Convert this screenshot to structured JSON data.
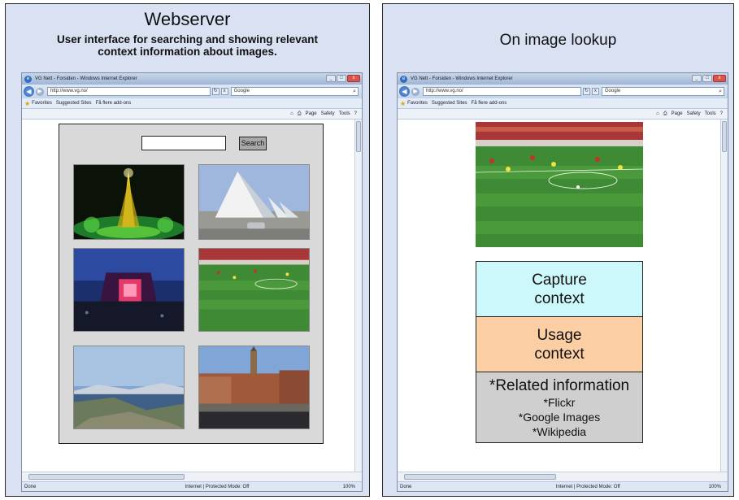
{
  "left_panel": {
    "title": "Webserver",
    "subtitle": "User interface for searching and showing relevant context information about images."
  },
  "right_panel": {
    "title": "On image lookup"
  },
  "browser": {
    "window_title": "VG Nett - Forsiden - Windows Internet Explorer",
    "url": "http://www.vg.no/",
    "search_engine": "Google",
    "favorites_label": "Favorites",
    "suggested_sites": "Suggested Sites",
    "addons_label": "Få flere add-ons",
    "command_items": [
      "Page",
      "Safety",
      "Tools"
    ],
    "status_left": "Done",
    "status_zone": "Internet | Protected Mode: Off",
    "zoom": "100%"
  },
  "webpage": {
    "search_button_label": "Search",
    "images": [
      {
        "subject": "eiffel-tower-night"
      },
      {
        "subject": "triangular-church"
      },
      {
        "subject": "concert-stage"
      },
      {
        "subject": "football-match"
      },
      {
        "subject": "coastal-landscape"
      },
      {
        "subject": "city-hall-square"
      }
    ]
  },
  "lookup": {
    "image_subject": "football-match",
    "capture_context": "Capture context",
    "usage_context": "Usage context",
    "related_title": "*Related information",
    "related_items": [
      "*Flickr",
      "*Google Images",
      "*Wikipedia"
    ]
  },
  "colors": {
    "panel_bg": "#d9e1f2",
    "capture_bg": "#ccf7fb",
    "usage_bg": "#fbcfa3",
    "related_bg": "#cfcfcf"
  }
}
